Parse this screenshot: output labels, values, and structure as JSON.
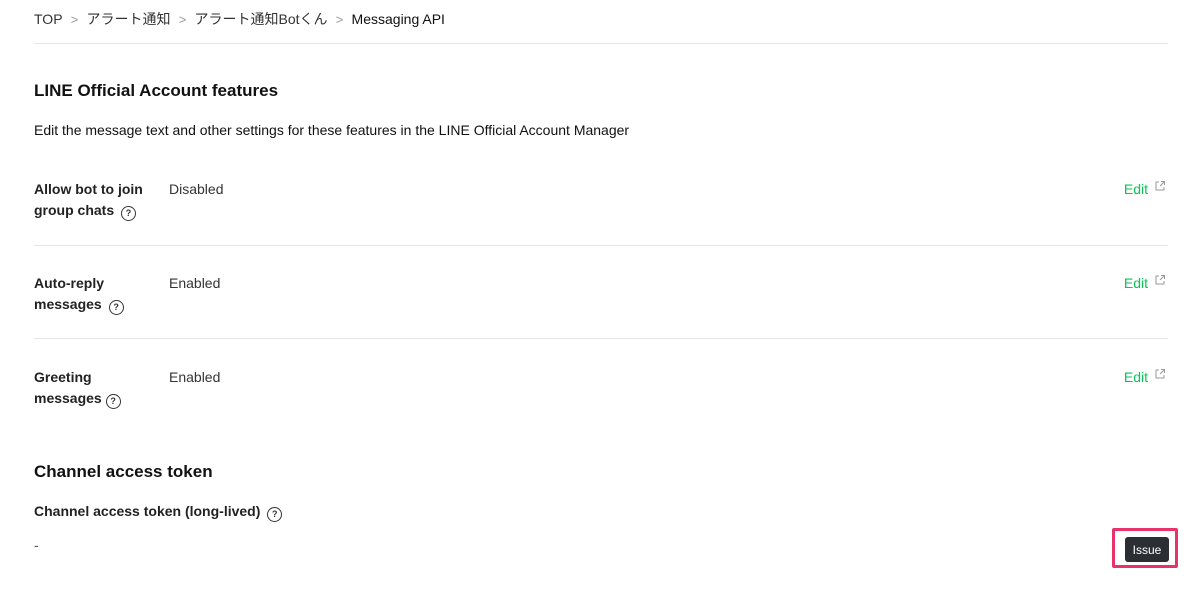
{
  "breadcrumb": {
    "items": [
      "TOP",
      "アラート通知",
      "アラート通知Botくん",
      "Messaging API"
    ],
    "separator": ">"
  },
  "features": {
    "title": "LINE Official Account features",
    "description": "Edit the message text and other settings for these features in the LINE Official Account Manager",
    "rows": [
      {
        "label": "Allow bot to join group chats",
        "value": "Disabled",
        "action": "Edit"
      },
      {
        "label": "Auto-reply messages",
        "value": "Enabled",
        "action": "Edit"
      },
      {
        "label": "Greeting messages",
        "value": "Enabled",
        "action": "Edit"
      }
    ]
  },
  "channel_access_token": {
    "title": "Channel access token",
    "long_lived_label": "Channel access token (long-lived)",
    "value": "-",
    "issue_button": "Issue"
  },
  "icons": {
    "help": "question-circle-icon",
    "external": "external-link-icon",
    "help_glyph": "?"
  },
  "colors": {
    "link_green": "#06c755",
    "highlight_pink": "#e8336a",
    "button_dark": "#2b2f33"
  }
}
